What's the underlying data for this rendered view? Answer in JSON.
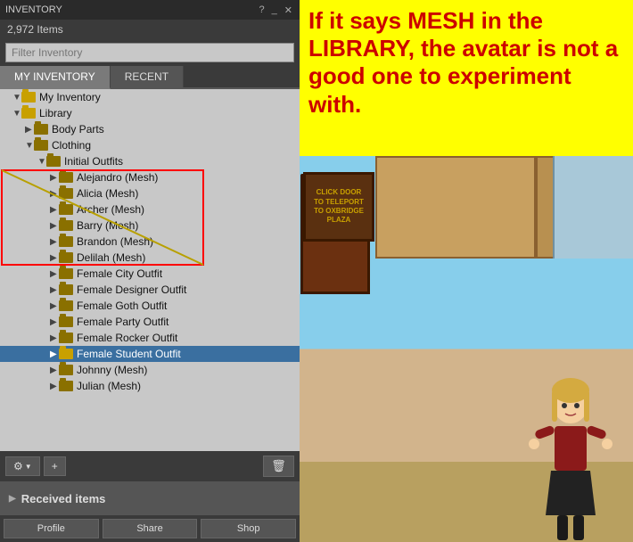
{
  "title_bar": {
    "title": "INVENTORY",
    "help": "?",
    "minimize": "_",
    "close": "✕"
  },
  "item_count": "2,972 Items",
  "search": {
    "placeholder": "Filter Inventory",
    "value": ""
  },
  "tabs": {
    "my_inventory": "MY INVENTORY",
    "recent": "RECENT"
  },
  "tree": {
    "items": [
      {
        "id": "my-inventory",
        "label": "My Inventory",
        "level": 1,
        "arrow": "▼",
        "type": "folder",
        "selected": false
      },
      {
        "id": "library",
        "label": "Library",
        "level": 1,
        "arrow": "▼",
        "type": "folder",
        "selected": false
      },
      {
        "id": "body-parts",
        "label": "Body Parts",
        "level": 2,
        "arrow": "▶",
        "type": "folder",
        "selected": false
      },
      {
        "id": "clothing",
        "label": "Clothing",
        "level": 2,
        "arrow": "▼",
        "type": "folder",
        "selected": false
      },
      {
        "id": "initial-outfits",
        "label": "Initial Outfits",
        "level": 3,
        "arrow": "▼",
        "type": "folder",
        "selected": false
      },
      {
        "id": "alejandro-mesh",
        "label": "Alejandro (Mesh)",
        "level": 4,
        "arrow": "▶",
        "type": "folder",
        "selected": false,
        "mesh": true
      },
      {
        "id": "alicia-mesh",
        "label": "Alicia (Mesh)",
        "level": 4,
        "arrow": "▶",
        "type": "folder",
        "selected": false,
        "mesh": true
      },
      {
        "id": "archer-mesh",
        "label": "Archer (Mesh)",
        "level": 4,
        "arrow": "▶",
        "type": "folder",
        "selected": false,
        "mesh": true
      },
      {
        "id": "barry-mesh",
        "label": "Barry (Mesh)",
        "level": 4,
        "arrow": "▶",
        "type": "folder",
        "selected": false,
        "mesh": true
      },
      {
        "id": "brandon-mesh",
        "label": "Brandon (Mesh)",
        "level": 4,
        "arrow": "▶",
        "type": "folder",
        "selected": false,
        "mesh": true
      },
      {
        "id": "delilah-mesh",
        "label": "Delilah (Mesh)",
        "level": 4,
        "arrow": "▶",
        "type": "folder",
        "selected": false,
        "mesh": true
      },
      {
        "id": "female-city-outfit",
        "label": "Female City Outfit",
        "level": 4,
        "arrow": "▶",
        "type": "folder",
        "selected": false
      },
      {
        "id": "female-designer-outfit",
        "label": "Female Designer Outfit",
        "level": 4,
        "arrow": "▶",
        "type": "folder",
        "selected": false
      },
      {
        "id": "female-goth-outfit",
        "label": "Female Goth Outfit",
        "level": 4,
        "arrow": "▶",
        "type": "folder",
        "selected": false
      },
      {
        "id": "female-party-outfit",
        "label": "Female Party Outfit",
        "level": 4,
        "arrow": "▶",
        "type": "folder",
        "selected": false
      },
      {
        "id": "female-rocker-outfit",
        "label": "Female Rocker Outfit",
        "level": 4,
        "arrow": "▶",
        "type": "folder",
        "selected": false
      },
      {
        "id": "female-student-outfit",
        "label": "Female Student Outfit",
        "level": 4,
        "arrow": "▶",
        "type": "folder",
        "selected": true
      },
      {
        "id": "johnny-mesh",
        "label": "Johnny (Mesh)",
        "level": 4,
        "arrow": "▶",
        "type": "folder",
        "selected": false
      },
      {
        "id": "julian-mesh",
        "label": "Julian (Mesh)",
        "level": 4,
        "arrow": "▶",
        "type": "folder",
        "selected": false
      }
    ]
  },
  "toolbar": {
    "gear_label": "⚙",
    "plus_label": "+",
    "trash_label": "🗑"
  },
  "received_items": {
    "label": "Received items",
    "arrow": "▶"
  },
  "bottom_buttons": {
    "profile": "Profile",
    "share": "Share",
    "shop": "Shop"
  },
  "annotation": {
    "text": "If it says MESH in the LIBRARY, the avatar is not a good one to experiment with."
  },
  "teleport_sign": {
    "line1": "Click Door",
    "line2": "to Teleport",
    "line3": "to Oxbridge",
    "line4": "Plaza"
  },
  "colors": {
    "accent_blue": "#3a6fa0",
    "folder_yellow": "#c8a000",
    "mesh_red_border": "#ff0000",
    "annotation_bg": "#ffff00",
    "annotation_text": "#cc0000"
  }
}
